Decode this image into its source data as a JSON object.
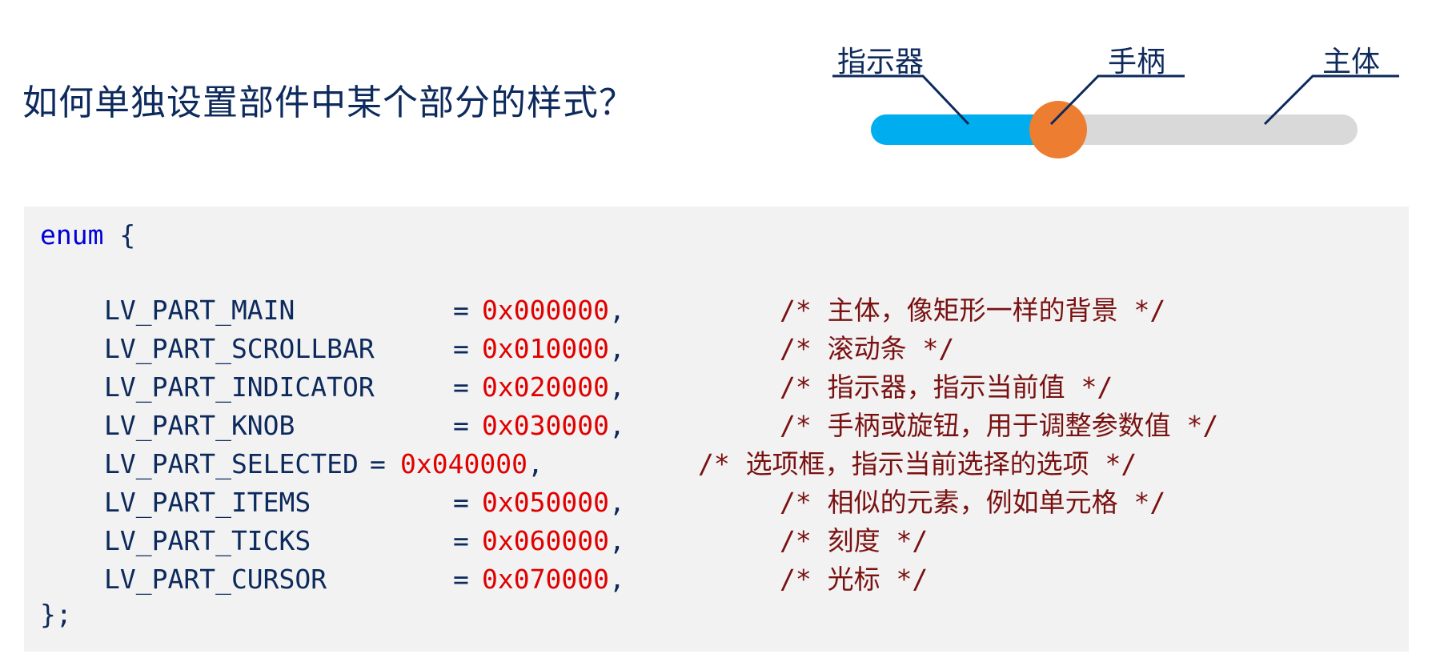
{
  "title": "如何单独设置部件中某个部分的样式？",
  "diagram": {
    "labels": {
      "indicator": "指示器",
      "knob": "手柄",
      "main": "主体"
    },
    "colors": {
      "indicator": "#00aeef",
      "knob": "#ed7d31",
      "main": "#d9d9d9",
      "leader": "#0d2a5c"
    },
    "indicator_fraction": 0.38
  },
  "code": {
    "keyword": "enum",
    "open_brace": "{",
    "close": "};",
    "entries": [
      {
        "name": "LV_PART_MAIN",
        "eq": "=",
        "value": "0x000000",
        "comma": ",",
        "comment": "/* 主体，像矩形一样的背景 */"
      },
      {
        "name": "LV_PART_SCROLLBAR",
        "eq": "=",
        "value": "0x010000",
        "comma": ",",
        "comment": "/* 滚动条 */"
      },
      {
        "name": "LV_PART_INDICATOR",
        "eq": "=",
        "value": "0x020000",
        "comma": ",",
        "comment": "/* 指示器，指示当前值 */"
      },
      {
        "name": "LV_PART_KNOB",
        "eq": "=",
        "value": "0x030000",
        "comma": ",",
        "comment": "/* 手柄或旋钮，用于调整参数值 */"
      },
      {
        "name": "LV_PART_SELECTED",
        "eq": "=",
        "value": "0x040000",
        "comma": ",",
        "comment": "/* 选项框，指示当前选择的选项 */"
      },
      {
        "name": "LV_PART_ITEMS",
        "eq": "=",
        "value": "0x050000",
        "comma": ",",
        "comment": "/* 相似的元素，例如单元格 */"
      },
      {
        "name": "LV_PART_TICKS",
        "eq": "=",
        "value": "0x060000",
        "comma": ",",
        "comment": "/* 刻度 */"
      },
      {
        "name": "LV_PART_CURSOR",
        "eq": "=",
        "value": "0x070000",
        "comma": ",",
        "comment": "/* 光标 */"
      }
    ]
  }
}
